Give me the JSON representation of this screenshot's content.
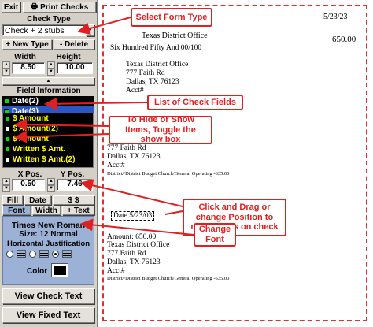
{
  "toolbar": {
    "exit_label": "Exit",
    "print_label": "Print Checks"
  },
  "check_type": {
    "label": "Check Type",
    "value": "Check + 2 stubs",
    "new_label": "+ New Type",
    "delete_label": "- Delete"
  },
  "size": {
    "width_label": "Width",
    "width_value": "8.50",
    "height_label": "Height",
    "height_value": "10.00"
  },
  "fields": {
    "label": "Field Information",
    "items": [
      {
        "label": "Date(2)",
        "color": "#00e000"
      },
      {
        "label": "Date(3)",
        "color": "#00e000"
      },
      {
        "label": "$ Amount",
        "color": "#00e000"
      },
      {
        "label": "$ Amount(2)",
        "color": "#ffffff"
      },
      {
        "label": "$ Amount",
        "color": "#00e000"
      },
      {
        "label": "Written $ Amt.",
        "color": "#00e000"
      },
      {
        "label": "Written $ Amt.(2)",
        "color": "#ffffff"
      }
    ]
  },
  "position": {
    "x_label": "X Pos.",
    "x_value": "0.50",
    "y_label": "Y Pos.",
    "y_value": "7.46"
  },
  "tabs": {
    "fill": "Fill",
    "date": "Date",
    "dollar": "$ $",
    "font": "Font",
    "width": "Width",
    "text": "+ Text"
  },
  "font": {
    "name": "Times New Roman",
    "size": "Size: 12   Normal",
    "justify_label": "Horizontal Justification",
    "color_label": "Color"
  },
  "bottom": {
    "view_check": "View Check Text",
    "view_fixed": "View Fixed Text"
  },
  "check": {
    "date_top": "5/23/23",
    "payee_top": "Texas District Office",
    "amount_top": "650.00",
    "written": "Six Hundred Fifty  And 00/100",
    "addr1_name": "Texas District Office",
    "addr1_street": "777 Faith Rd",
    "addr1_city": "Dallas, TX    76123",
    "addr1_acct": "Acct#",
    "stub1_street": "777 Faith Rd",
    "stub1_city": "Dallas, TX    76123",
    "stub1_acct": "Acct#",
    "stub1_memo": "District//District Budget  Church/General Operating  -635.00",
    "date_sel": "Date 5/23/03",
    "stub2_amount": "Amount: 650.00",
    "stub2_name": "Texas District Office",
    "stub2_street": "777 Faith Rd",
    "stub2_city": "Dallas, TX    76123",
    "stub2_acct": "Acct#",
    "stub2_memo": "District//District Budget  Church/General Operating  -635.00"
  },
  "callouts": {
    "form_type": "Select Form Type",
    "list_fields": "List of Check  Fields",
    "hide_show": "To Hide or Show Items, Toggle the show box",
    "drag": "Click and Drag or change Position to move items on check",
    "font": "Change Font"
  },
  "colors": {
    "accent": "#e02020",
    "panel": "#d4d0c8",
    "font_box": "#9bb1d6",
    "selection": "#2a56c6"
  }
}
